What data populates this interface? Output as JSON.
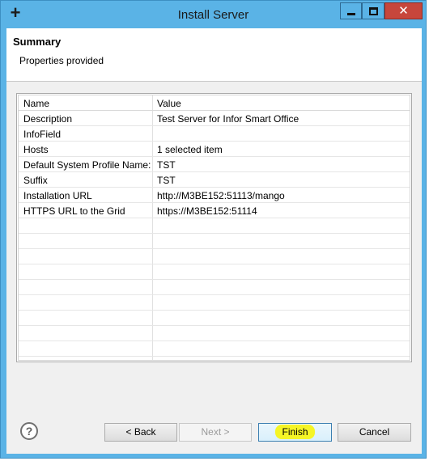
{
  "window": {
    "title": "Install Server"
  },
  "header": {
    "title": "Summary",
    "description": "Properties provided"
  },
  "table": {
    "columns": [
      "Name",
      "Value"
    ],
    "rows": [
      {
        "name": "Description",
        "value": "Test Server for Infor Smart Office"
      },
      {
        "name": "InfoField",
        "value": ""
      },
      {
        "name": "Hosts",
        "value": "1 selected item"
      },
      {
        "name": "Default System Profile Name:",
        "value": "TST"
      },
      {
        "name": "Suffix",
        "value": "TST"
      },
      {
        "name": "Installation URL",
        "value": "http://M3BE152:51113/mango"
      },
      {
        "name": "HTTPS URL to the Grid",
        "value": "https://M3BE152:51114"
      },
      {
        "name": "",
        "value": ""
      },
      {
        "name": "",
        "value": ""
      },
      {
        "name": "",
        "value": ""
      },
      {
        "name": "",
        "value": ""
      },
      {
        "name": "",
        "value": ""
      },
      {
        "name": "",
        "value": ""
      },
      {
        "name": "",
        "value": ""
      },
      {
        "name": "",
        "value": ""
      },
      {
        "name": "",
        "value": ""
      },
      {
        "name": "",
        "value": ""
      }
    ]
  },
  "buttons": {
    "back": "< Back",
    "next": "Next >",
    "finish": "Finish",
    "cancel": "Cancel"
  },
  "icons": {
    "help": "?",
    "app": "+",
    "close": "✕"
  },
  "colors": {
    "frame": "#5ab3e6",
    "close": "#c7463b",
    "highlight": "#f5f526"
  }
}
